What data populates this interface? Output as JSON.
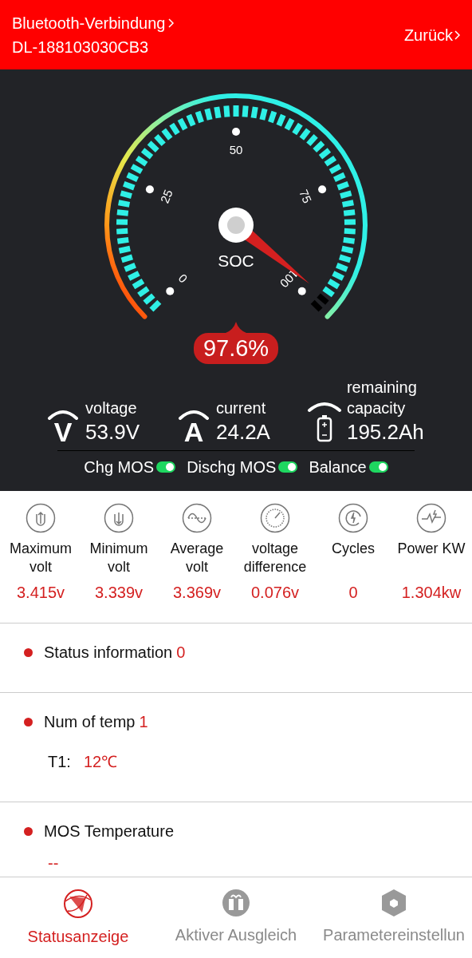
{
  "header": {
    "title": "Bluetooth-Verbindung",
    "device": "DL-188103030CB3",
    "back": "Zurück"
  },
  "gauge": {
    "label": "SOC",
    "ticks": [
      "0",
      "25",
      "50",
      "75",
      "100"
    ],
    "reading": "97.6%"
  },
  "metrics": [
    {
      "kind": "letter",
      "symbol": "V",
      "label": "voltage",
      "value": "53.9V"
    },
    {
      "kind": "letter",
      "symbol": "A",
      "label": "current",
      "value": "24.2A"
    },
    {
      "kind": "battery",
      "label": "remaining capacity",
      "value": "195.2Ah"
    }
  ],
  "switches": [
    {
      "label": "Chg MOS",
      "on": true
    },
    {
      "label": "Dischg MOS",
      "on": true
    },
    {
      "label": "Balance",
      "on": true
    }
  ],
  "stats": [
    {
      "kind": "max",
      "label": "Maximum volt",
      "value": "3.415v"
    },
    {
      "kind": "min",
      "label": "Minimum volt",
      "value": "3.339v"
    },
    {
      "kind": "avg",
      "label": "Average volt",
      "value": "3.369v"
    },
    {
      "kind": "diff",
      "label": "voltage difference",
      "value": "0.076v"
    },
    {
      "kind": "cycles",
      "label": "Cycles",
      "value": "0"
    },
    {
      "kind": "power",
      "label": "Power KW",
      "value": "1.304kw"
    }
  ],
  "sections": [
    {
      "title": "Status information",
      "count": "0"
    },
    {
      "title": "Num of temp",
      "count": "1",
      "rows": [
        {
          "label": "T1:",
          "value": "12℃"
        }
      ]
    },
    {
      "title": "MOS Temperature",
      "rows": [
        {
          "value": "--"
        }
      ]
    }
  ],
  "nav": [
    {
      "kind": "globe",
      "label": "Statusanzeige",
      "selected": true
    },
    {
      "kind": "gift",
      "label": "Aktiver Ausgleich",
      "selected": false
    },
    {
      "kind": "hexagon",
      "label": "Parametereinstellun",
      "selected": false
    }
  ]
}
